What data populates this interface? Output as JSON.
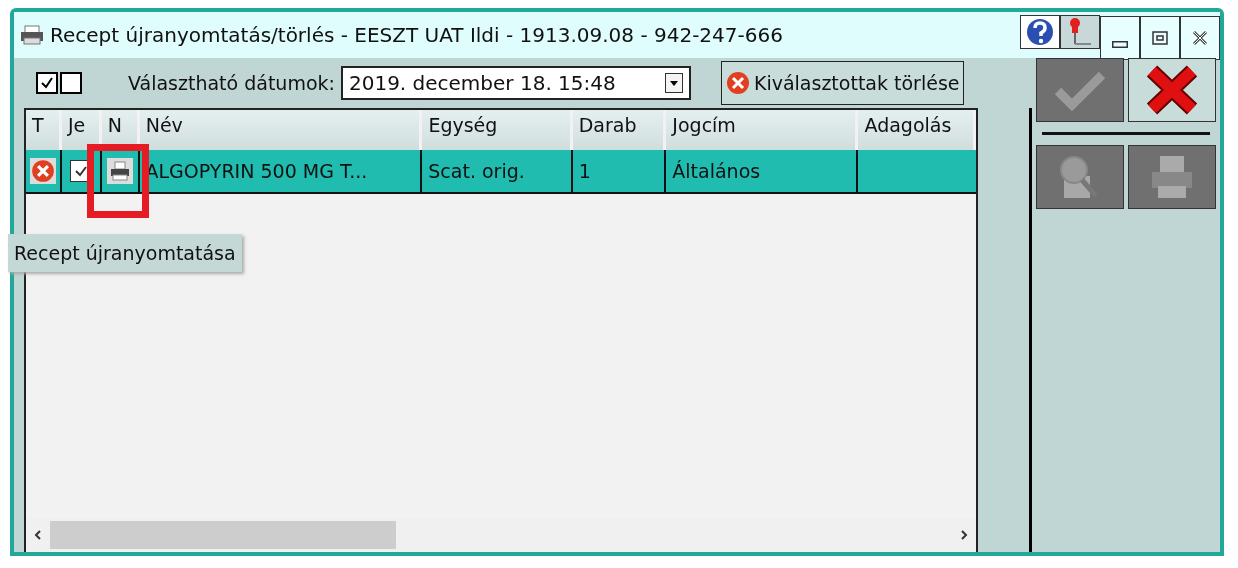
{
  "window": {
    "title": "Recept újranyomtatás/törlés - EESZT UAT Ildi - 1913.09.08 - 942-247-666"
  },
  "toolbar": {
    "select_toggles": [
      {
        "checked": true
      },
      {
        "checked": false
      }
    ],
    "date_label": "Választható dátumok:",
    "date_value": "2019. december 18. 15:48",
    "delete_button": "Kiválasztottak törlése"
  },
  "table": {
    "columns": [
      "T",
      "Je",
      "N",
      "Név",
      "Egység",
      "Darab",
      "Jogcím",
      "Adagolás"
    ],
    "rows": [
      {
        "selected": true,
        "checked": true,
        "name": "ALGOPYRIN 500 MG T...",
        "unit": "Scat. orig.",
        "count": "1",
        "title": "Általános"
      }
    ]
  },
  "actions": [
    {
      "kind": "ok",
      "disabled": true
    },
    {
      "kind": "cancel",
      "disabled": false
    },
    {
      "kind": "preview",
      "disabled": true
    },
    {
      "kind": "print",
      "disabled": true
    }
  ],
  "tooltip": "Recept újranyomtatása"
}
